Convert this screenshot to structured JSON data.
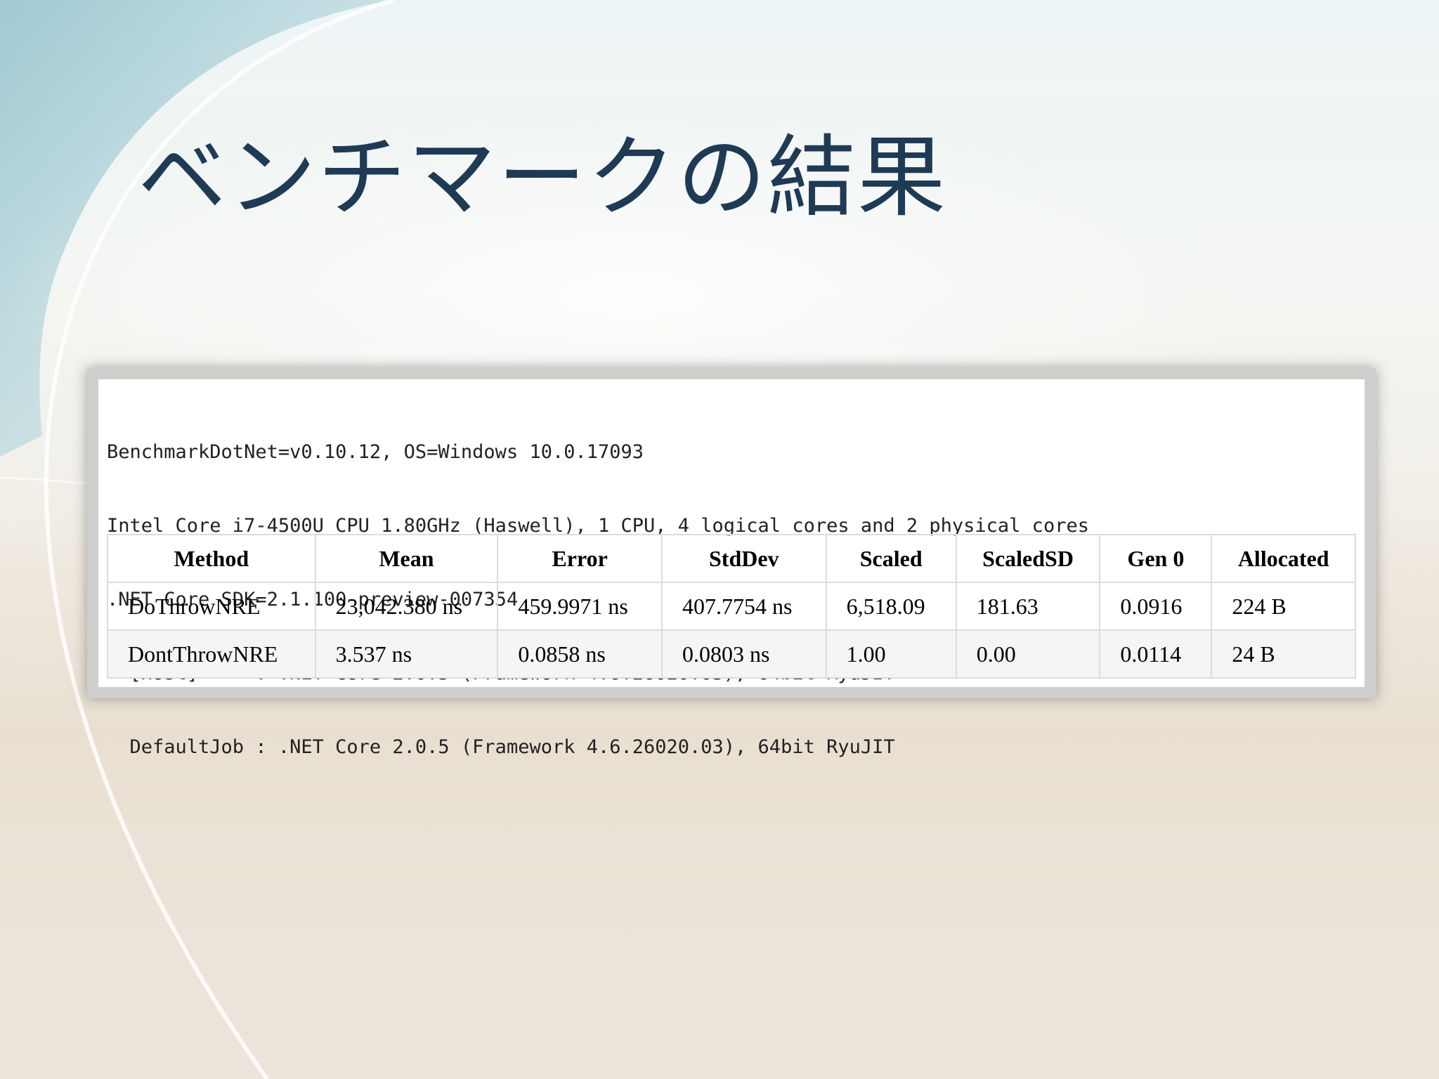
{
  "slide": {
    "title": "ベンチマークの結果"
  },
  "environment": {
    "lines": [
      "BenchmarkDotNet=v0.10.12, OS=Windows 10.0.17093",
      "Intel Core i7-4500U CPU 1.80GHz (Haswell), 1 CPU, 4 logical cores and 2 physical cores",
      ".NET Core SDK=2.1.100-preview-007354",
      "  [Host]     : .NET Core 2.0.5 (Framework 4.6.26020.03), 64bit RyuJIT",
      "  DefaultJob : .NET Core 2.0.5 (Framework 4.6.26020.03), 64bit RyuJIT"
    ]
  },
  "results": {
    "columns": [
      "Method",
      "Mean",
      "Error",
      "StdDev",
      "Scaled",
      "ScaledSD",
      "Gen 0",
      "Allocated"
    ],
    "rows": [
      [
        "DoThrowNRE",
        "23,042.380 ns",
        "459.9971 ns",
        "407.7754 ns",
        "6,518.09",
        "181.63",
        "0.0916",
        "224 B"
      ],
      [
        "DontThrowNRE",
        "3.537 ns",
        "0.0858 ns",
        "0.0803 ns",
        "1.00",
        "0.00",
        "0.0114",
        "24 B"
      ]
    ]
  }
}
